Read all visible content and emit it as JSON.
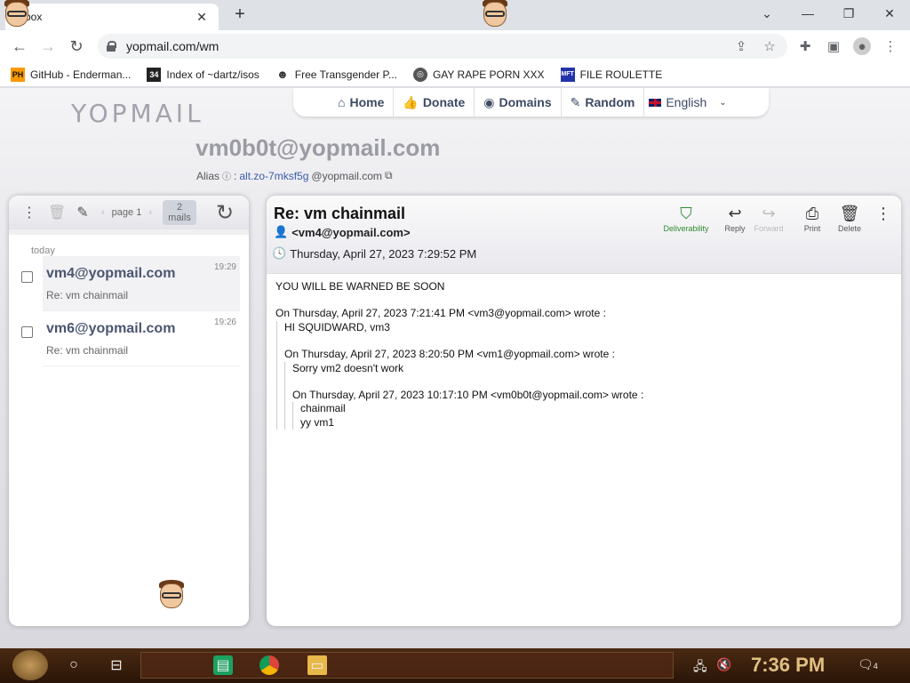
{
  "browser": {
    "tab_title": "Inbox",
    "url": "yopmail.com/wm",
    "bookmarks": [
      {
        "label": "GitHub - Enderman...",
        "icon": "ph-icon"
      },
      {
        "label": "Index of ~dartz/isos",
        "icon": "34-icon"
      },
      {
        "label": "Free Transgender P...",
        "icon": "mask-icon"
      },
      {
        "label": "GAY RAPE PORN XXX",
        "icon": "globe-icon"
      },
      {
        "label": "FILE ROULETTE",
        "icon": "mft-icon"
      }
    ]
  },
  "site": {
    "logo": "YOPMAIL",
    "nav": [
      {
        "label": "Home",
        "icon": "home-icon"
      },
      {
        "label": "Donate",
        "icon": "thumbs-up-icon"
      },
      {
        "label": "Domains",
        "icon": "globe-icon"
      },
      {
        "label": "Random",
        "icon": "magic-wand-icon"
      }
    ],
    "language": "English",
    "address": "vm0b0t@yopmail.com",
    "alias_label": "Alias",
    "alias_value": "alt.zo-7mksf5g",
    "alias_domain": "@yopmail.com"
  },
  "inbox": {
    "page_label": "page 1",
    "mail_count": "2",
    "mail_count_label": "mails",
    "group": "today",
    "mails": [
      {
        "from": "vm4@yopmail.com",
        "subject": "Re: vm chainmail",
        "time": "19:29"
      },
      {
        "from": "vm6@yopmail.com",
        "subject": "Re: vm chainmail",
        "time": "19:26"
      }
    ]
  },
  "message": {
    "subject": "Re: vm chainmail",
    "from": "<vm4@yopmail.com>",
    "date": "Thursday, April 27, 2023 7:29:52 PM",
    "actions": {
      "deliverability": "Deliverability",
      "reply": "Reply",
      "forward": "Forward",
      "print": "Print",
      "delete": "Delete"
    },
    "body_line1": "YOU WILL BE WARNED BE SOON",
    "q1_header": "On Thursday, April 27, 2023 7:21:41 PM <vm3@yopmail.com> wrote :",
    "q1_text": "HI SQUIDWARD, vm3",
    "q2_header": "On Thursday, April 27, 2023 8:20:50 PM <vm1@yopmail.com> wrote :",
    "q2_text": "Sorry vm2 doesn't work",
    "q3_header": "On Thursday, April 27, 2023 10:17:10 PM <vm0b0t@yopmail.com> wrote :",
    "q3_text1": "chainmail",
    "q3_text2": "yy vm1"
  },
  "taskbar": {
    "clock": "7:36 PM",
    "notifications": "4"
  }
}
